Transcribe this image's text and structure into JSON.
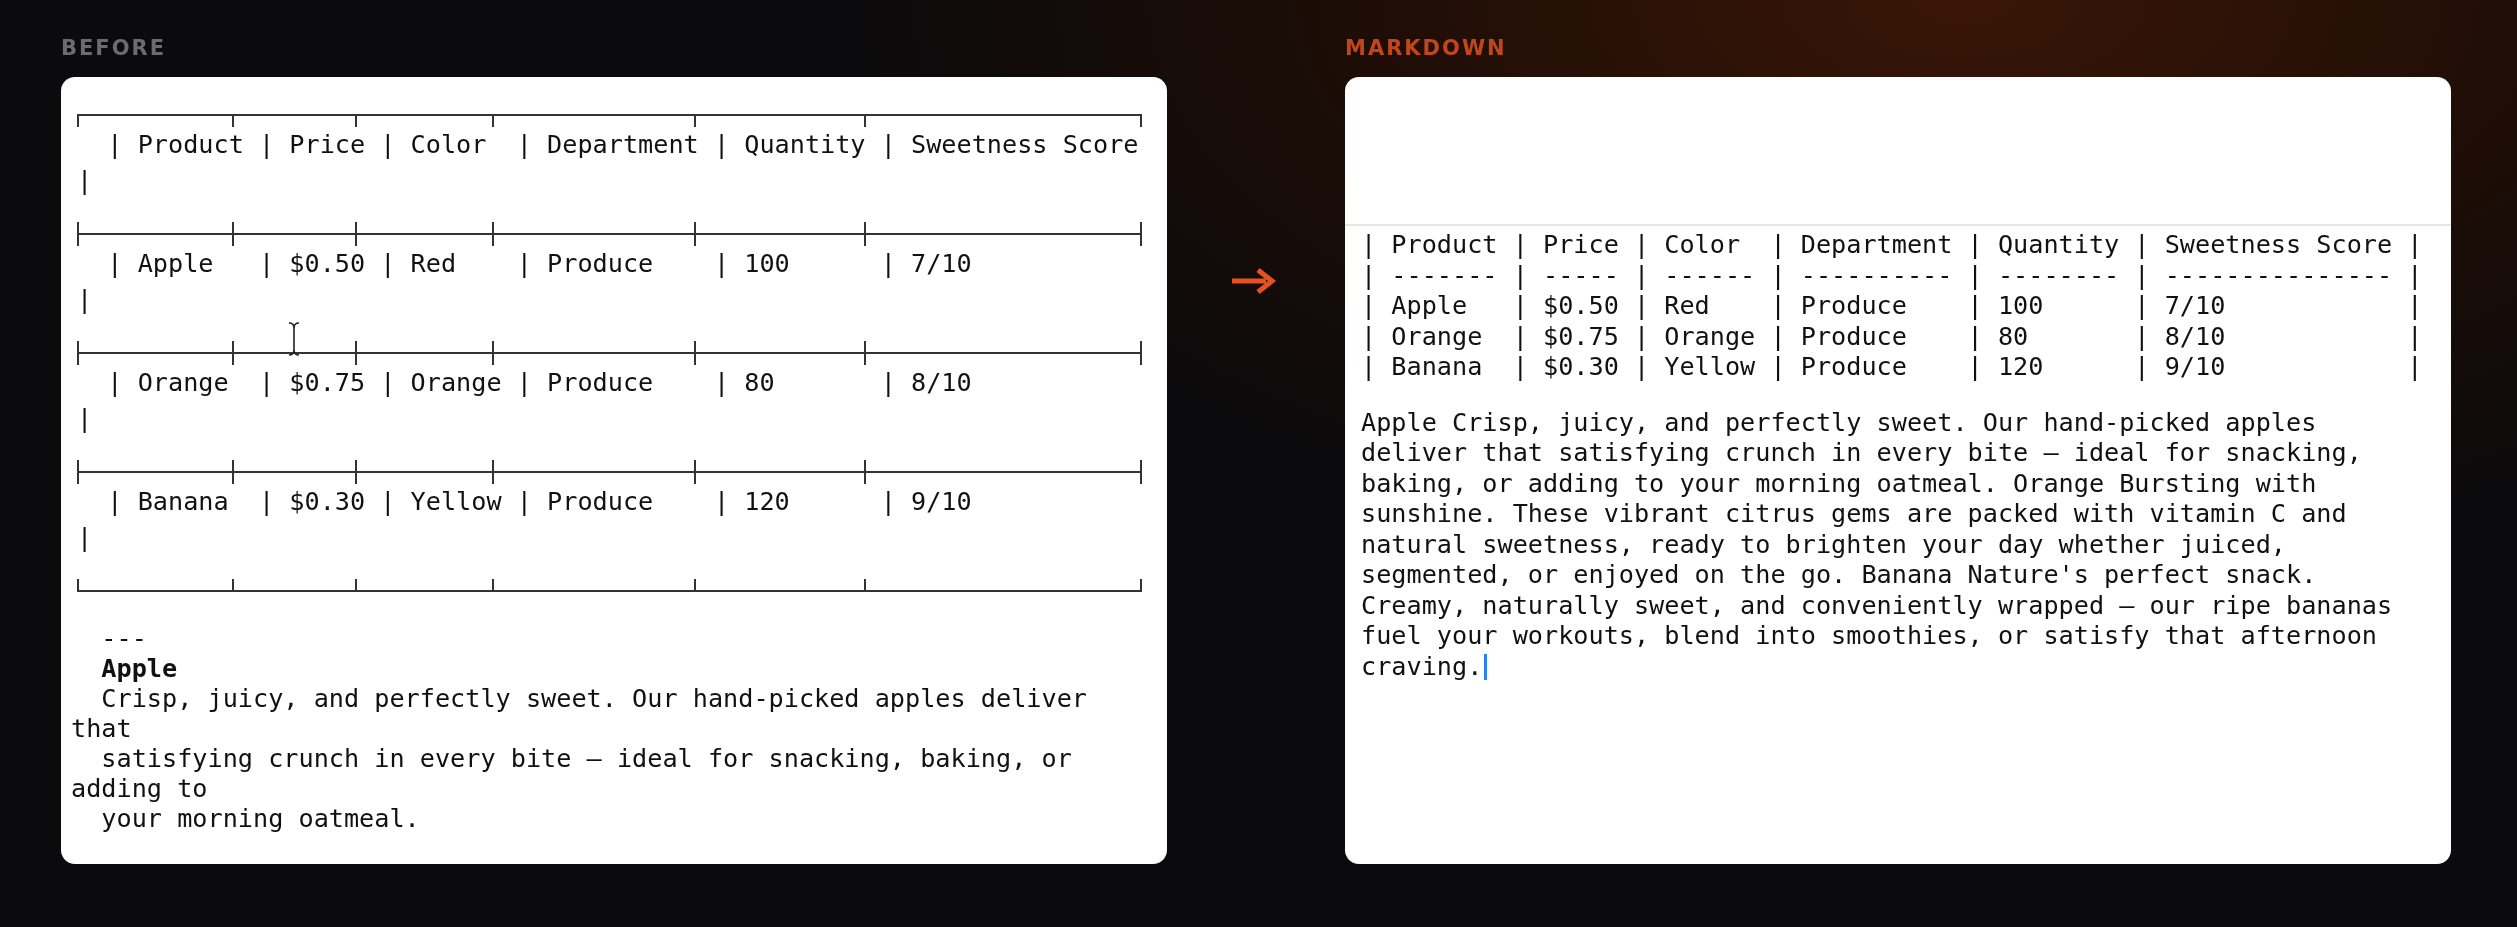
{
  "before": {
    "label": "BEFORE",
    "table_rows": [
      {
        "text": "| Product | Price | Color  | Department | Quantity | Sweetness Score",
        "tail": "|"
      },
      {
        "text": "| Apple   | $0.50 | Red    | Produce    | 100      | 7/10",
        "tail": "|"
      },
      {
        "text": "| Orange  | $0.75 | Orange | Produce    | 80       | 8/10",
        "tail": "|"
      },
      {
        "text": "| Banana  | $0.30 | Yellow | Produce    | 120      | 9/10",
        "tail": "|"
      }
    ],
    "text_lines": [
      {
        "kind": "rule",
        "text": "---",
        "indent": true
      },
      {
        "kind": "heading",
        "text": "Apple",
        "indent": true
      },
      {
        "kind": "plain",
        "text": "Crisp, juicy, and perfectly sweet. Our hand-picked apples deliver",
        "indent": true
      },
      {
        "kind": "plain",
        "text": "that",
        "indent": false
      },
      {
        "kind": "plain",
        "text": "satisfying crunch in every bite — ideal for snacking, baking, or",
        "indent": true
      },
      {
        "kind": "plain",
        "text": "adding to",
        "indent": false
      },
      {
        "kind": "plain",
        "text": "your morning oatmeal.",
        "indent": true
      }
    ]
  },
  "markdown": {
    "label": "MARKDOWN",
    "table_lines": [
      "| Product | Price | Color  | Department | Quantity | Sweetness Score |",
      "| ------- | ----- | ------ | ---------- | -------- | --------------- |",
      "| Apple   | $0.50 | Red    | Produce    | 100      | 7/10            |",
      "| Orange  | $0.75 | Orange | Produce    | 80       | 8/10            |",
      "| Banana  | $0.30 | Yellow | Produce    | 120      | 9/10            |"
    ],
    "paragraph": "Apple Crisp, juicy, and perfectly sweet. Our hand-picked apples deliver that satisfying crunch in every bite — ideal for snacking, baking, or adding to your morning oatmeal. Orange Bursting with sunshine. These vibrant citrus gems are packed with vitamin C and natural sweetness, ready to brighten your day whether juiced, segmented, or enjoyed on the go. Banana Nature's perfect snack. Creamy, naturally sweet, and conveniently wrapped — our ripe bananas fuel your workouts, blend into smoothies, or satisfy that afternoon craving."
  }
}
